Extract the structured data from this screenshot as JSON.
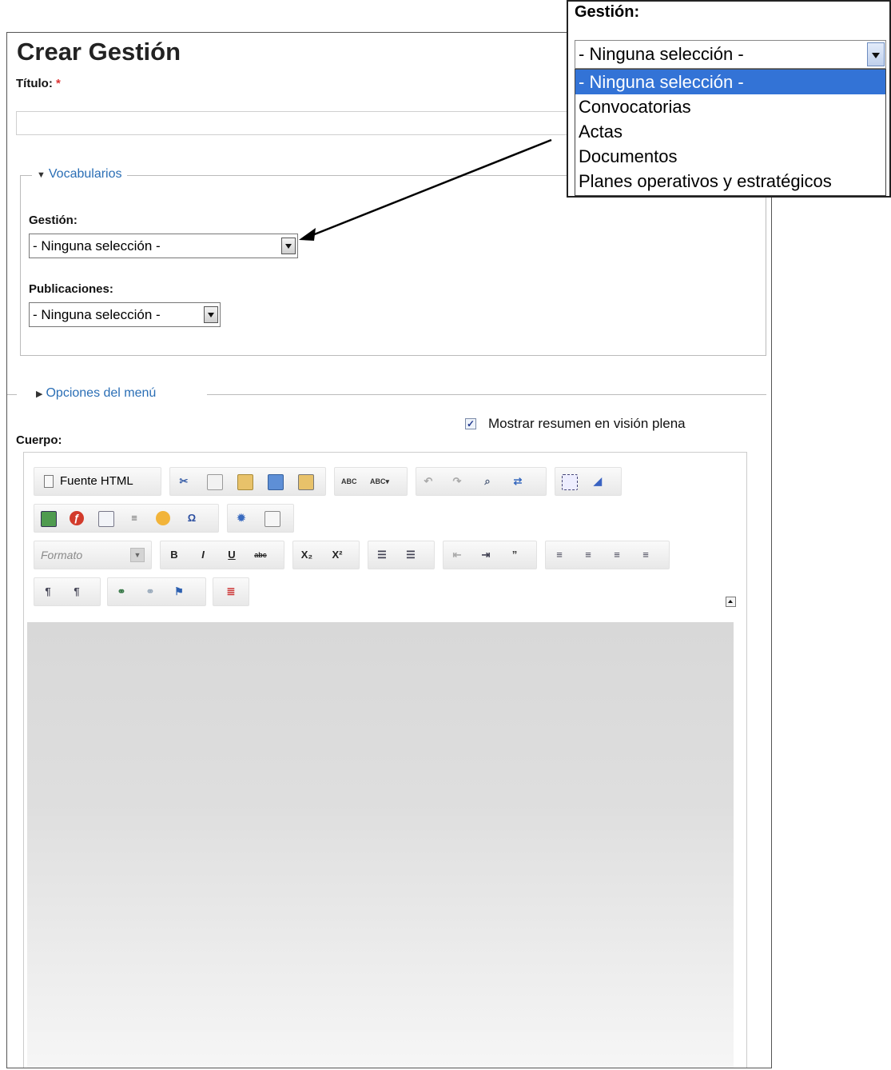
{
  "page": {
    "title": "Crear Gestión"
  },
  "titulo": {
    "label": "Título:",
    "required": "*",
    "value": ""
  },
  "vocabularios": {
    "legend": "Vocabularios",
    "gestion": {
      "label": "Gestión:",
      "value": "- Ninguna selección -"
    },
    "publicaciones": {
      "label": "Publicaciones:",
      "value": "- Ninguna selección -"
    }
  },
  "menu_options": {
    "legend": "Opciones del menú"
  },
  "summary": {
    "label": "Mostrar resumen en visión plena",
    "checked": true
  },
  "body": {
    "label": "Cuerpo:",
    "source_button": "Fuente HTML",
    "format_placeholder": "Formato",
    "bold": "B",
    "italic": "I",
    "underline": "U",
    "strike": "abc",
    "sub": "X₂",
    "sup": "X²"
  },
  "dropdown_popup": {
    "label": "Gestión:",
    "value": "- Ninguna selección -",
    "options": [
      "- Ninguna selección -",
      "Convocatorias",
      "Actas",
      "Documentos",
      "Planes operativos y estratégicos"
    ]
  }
}
